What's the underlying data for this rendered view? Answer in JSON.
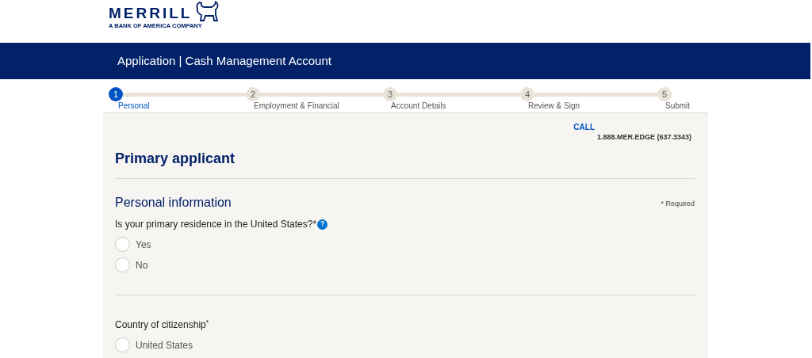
{
  "logo": {
    "wordmark": "MERRILL",
    "tagline": "A BANK OF AMERICA COMPANY"
  },
  "banner": {
    "title": "Application | Cash Management Account"
  },
  "steps": [
    {
      "number": "1",
      "label": "Personal",
      "selected": true
    },
    {
      "number": "2",
      "label": "Employment & Financial",
      "selected": false
    },
    {
      "number": "3",
      "label": "Account Details",
      "selected": false
    },
    {
      "number": "4",
      "label": "Review & Sign",
      "selected": false
    },
    {
      "number": "5",
      "label": "Submit",
      "selected": false
    }
  ],
  "call": {
    "label": "CALL",
    "phone": "1.888.MER.EDGE (637.3343)"
  },
  "heading": "Primary applicant",
  "section": {
    "title": "Personal information",
    "required_note": "* Required"
  },
  "questions": [
    {
      "label": "Is your primary residence in the United States?*",
      "help": "?",
      "options": [
        {
          "label": "Yes",
          "selected": false
        },
        {
          "label": "No",
          "selected": false
        }
      ]
    },
    {
      "label": "Country of citizenship$^{*}$",
      "options": [
        {
          "label": "United States",
          "selected": false
        }
      ]
    }
  ]
}
